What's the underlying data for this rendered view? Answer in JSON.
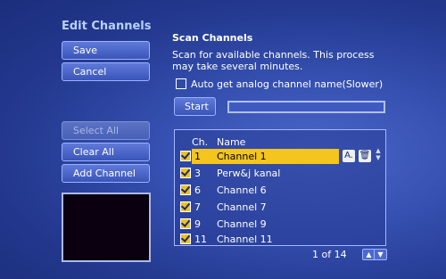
{
  "left_panel": {
    "title": "Edit Channels",
    "save_label": "Save",
    "cancel_label": "Cancel",
    "select_all_label": "Select All",
    "clear_all_label": "Clear All",
    "add_channel_label": "Add Channel"
  },
  "scan": {
    "heading": "Scan Channels",
    "description": "Scan for available channels. This process may take several minutes.",
    "auto_name_label": "Auto get analog channel name(Slower)",
    "auto_name_checked": false,
    "start_label": "Start",
    "progress": 0
  },
  "list": {
    "col_ch": "Ch.",
    "col_name": "Name",
    "rows": [
      {
        "ch": "1",
        "name": "Channel 1",
        "checked": true,
        "selected": true
      },
      {
        "ch": "3",
        "name": "Perw&j kanal",
        "checked": true,
        "selected": false
      },
      {
        "ch": "6",
        "name": "Channel 6",
        "checked": true,
        "selected": false
      },
      {
        "ch": "7",
        "name": "Channel 7",
        "checked": true,
        "selected": false
      },
      {
        "ch": "9",
        "name": "Channel 9",
        "checked": true,
        "selected": false
      },
      {
        "ch": "11",
        "name": "Channel 11",
        "checked": true,
        "selected": false
      }
    ],
    "rename_icon": "rename-icon",
    "delete_icon": "trash-icon",
    "rename_glyph": "A.",
    "up_glyph": "▲",
    "down_glyph": "▼",
    "pager_text": "1 of 14"
  },
  "colors": {
    "accent": "#f4c51e",
    "background": "#2d45a2"
  }
}
